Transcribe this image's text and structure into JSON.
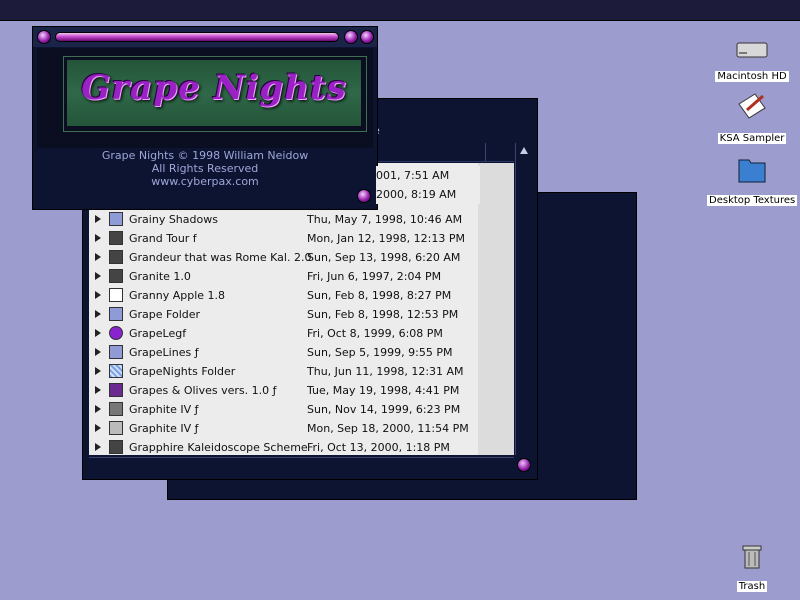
{
  "about": {
    "logo_text": "Grape Nights",
    "line1": "Grape Nights © 1998 William Neidow",
    "line2": "All Rights Reserved",
    "line3": "www.cyberpax.com"
  },
  "list_window": {
    "partial_title": "e",
    "partial_rows": [
      {
        "date": "001, 7:51 AM"
      },
      {
        "date": "2000, 8:19 AM"
      }
    ],
    "rows": [
      {
        "name": "Grainy Shadows",
        "date": "Thu, May 7, 1998, 10:46 AM",
        "icon": "folder"
      },
      {
        "name": "Grand Tour f",
        "date": "Mon, Jan 12, 1998, 12:13 PM",
        "icon": "theme"
      },
      {
        "name": "Grandeur that was Rome Kal. 2.0",
        "date": "Sun, Sep 13, 1998, 6:20 AM",
        "icon": "theme"
      },
      {
        "name": "Granite 1.0",
        "date": "Fri, Jun 6, 1997, 2:04 PM",
        "icon": "theme"
      },
      {
        "name": "Granny Apple 1.8",
        "date": "Sun, Feb 8, 1998, 8:27 PM",
        "icon": "document"
      },
      {
        "name": "Grape Folder",
        "date": "Sun, Feb 8, 1998, 12:53 PM",
        "icon": "folder"
      },
      {
        "name": "GrapeLegf",
        "date": "Fri, Oct 8, 1999, 6:08 PM",
        "icon": "purple-ball"
      },
      {
        "name": "GrapeLines ƒ",
        "date": "Sun, Sep 5, 1999, 9:55 PM",
        "icon": "folder"
      },
      {
        "name": "GrapeNights Folder",
        "date": "Thu, Jun 11, 1998, 12:31 AM",
        "icon": "grid"
      },
      {
        "name": "Grapes & Olives vers. 1.0 ƒ",
        "date": "Tue, May 19, 1998, 4:41 PM",
        "icon": "grapes"
      },
      {
        "name": "Graphite IV ƒ",
        "date": "Sun, Nov 14, 1999, 6:23 PM",
        "icon": "graphite"
      },
      {
        "name": "Graphite IV ƒ",
        "date": "Mon, Sep 18, 2000, 11:54 PM",
        "icon": "graphite-light"
      },
      {
        "name": "Grapphire Kaleidoscope Scheme",
        "date": "Fri, Oct 13, 2000, 1:18 PM",
        "icon": "theme"
      }
    ]
  },
  "desktop": {
    "icons": [
      {
        "label": "Macintosh HD",
        "icon": "hard-drive-icon"
      },
      {
        "label": "KSA Sampler",
        "icon": "document-pen-icon"
      },
      {
        "label": "Desktop Textures",
        "icon": "folder-icon"
      },
      {
        "label": "Trash",
        "icon": "trash-icon"
      }
    ]
  },
  "colors": {
    "desktop": "#9c9ccf",
    "window_dark": "#0d1432",
    "accent_purple": "#9a22c4"
  }
}
